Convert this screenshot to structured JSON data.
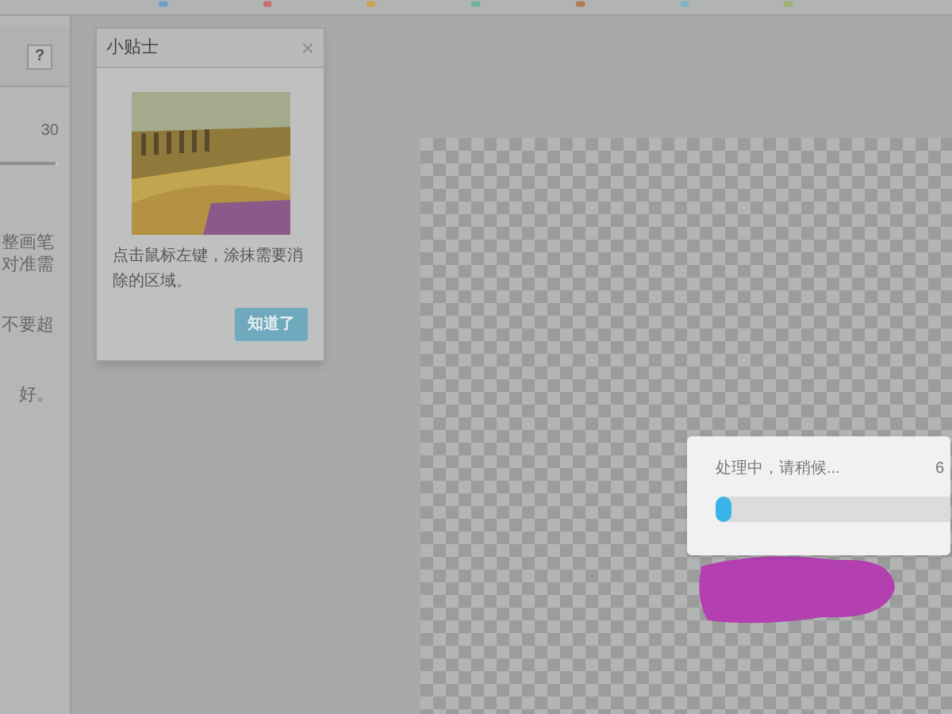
{
  "left_panel": {
    "help_button": "?",
    "slider": {
      "reading": "30",
      "level": 0.95
    },
    "texts": [
      "整画笔",
      "对准需",
      "不要超",
      "好。"
    ]
  },
  "tip_dialog": {
    "title": "小贴士",
    "close": "×",
    "message": "点击鼠标左键，涂抹需要消除的区域。",
    "ok_button": "知道了"
  },
  "progress_dialog": {
    "message": "处理中，请稍候...",
    "percent": "6",
    "level": 0.07
  }
}
